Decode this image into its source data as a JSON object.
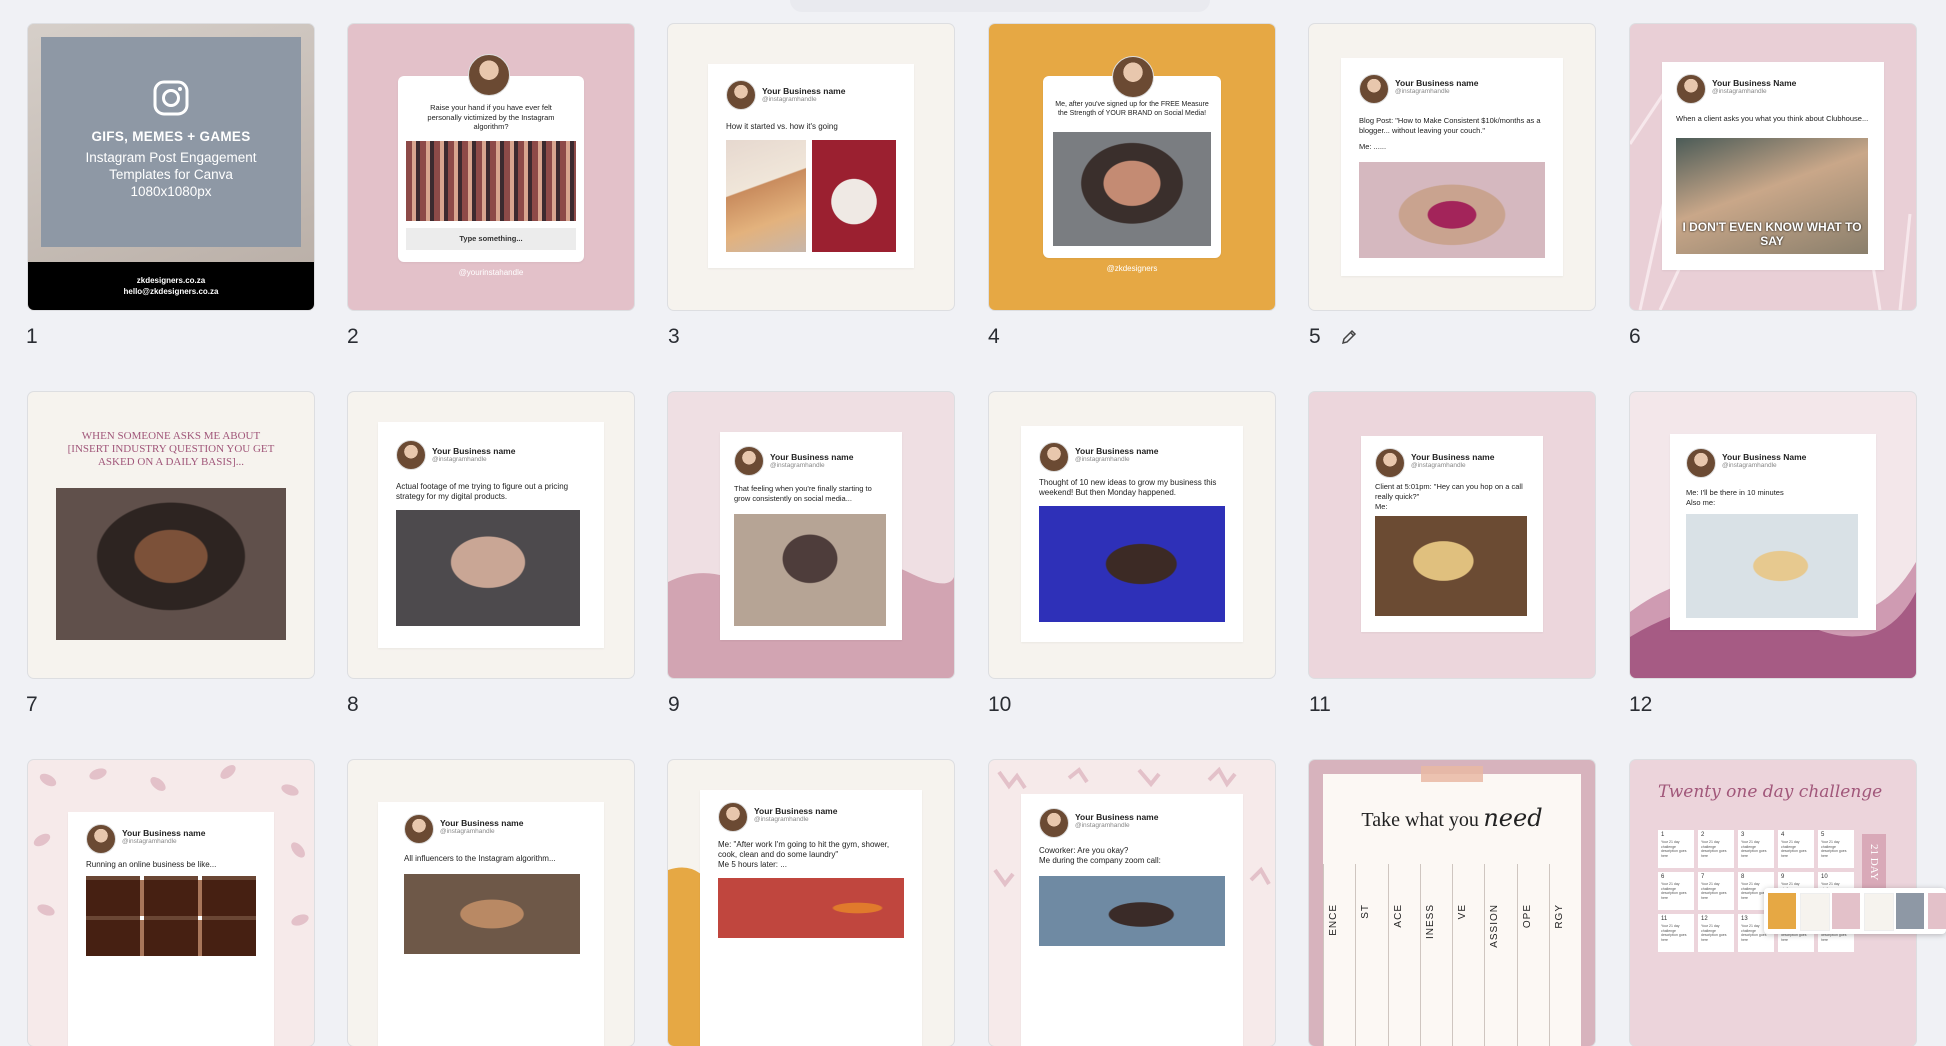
{
  "pages": [
    {
      "num": "1",
      "cover": {
        "title": "GIFS, MEMES + GAMES",
        "subtitle": "Instagram Post Engagement Templates for Canva 1080x1080px",
        "site": "zkdesigners.co.za",
        "email": "hello@zkdesigners.co.za"
      }
    },
    {
      "num": "2",
      "caption": "Raise your hand if you have ever felt personally victimized by the Instagram algorithm?",
      "input_placeholder": "Type something...",
      "handle": "@yourinstahandle"
    },
    {
      "num": "3",
      "business": "Your Business name",
      "handle": "@instagramhandle",
      "caption": "How it started vs. how it's going"
    },
    {
      "num": "4",
      "caption": "Me, after you've signed up for the FREE Measure the Strength of YOUR BRAND on Social Media!",
      "handle": "@zkdesigners"
    },
    {
      "num": "5",
      "business": "Your Business name",
      "handle": "@instagramhandle",
      "caption": "Blog Post: \"How to Make Consistent $10k/months as a blogger... without leaving your couch.\"",
      "caption2": "Me: ......"
    },
    {
      "num": "6",
      "business": "Your Business Name",
      "handle": "@instagramhandle",
      "caption": "When a client asks you what you think about Clubhouse...",
      "meme_text": "I DON'T EVEN KNOW WHAT TO SAY"
    },
    {
      "num": "7",
      "heading": "WHEN SOMEONE ASKS ME ABOUT [INSERT INDUSTRY QUESTION YOU GET ASKED ON A DAILY BASIS]..."
    },
    {
      "num": "8",
      "business": "Your Business name",
      "handle": "@instagramhandle",
      "caption": "Actual footage of me trying to figure out a pricing strategy for my digital products."
    },
    {
      "num": "9",
      "business": "Your Business name",
      "handle": "@instagramhandle",
      "caption": "That feeling when you're finally starting to grow consistently on social media..."
    },
    {
      "num": "10",
      "business": "Your Business name",
      "handle": "@instagramhandle",
      "caption": "Thought of 10 new ideas to grow my business this weekend! But then Monday happened."
    },
    {
      "num": "11",
      "business": "Your Business name",
      "handle": "@instagramhandle",
      "caption": "Client at 5:01pm: \"Hey can you hop on a call really quick?\"",
      "caption2": "Me:"
    },
    {
      "num": "12",
      "business": "Your Business Name",
      "handle": "@instagramhandle",
      "caption": "Me: I'll be there in 10 minutes",
      "caption2": "Also me:"
    },
    {
      "business": "Your Business name",
      "handle": "@instagramhandle",
      "caption": "Running an online business be like..."
    },
    {
      "business": "Your Business name",
      "handle": "@instagramhandle",
      "caption": "All influencers to the Instagram algorithm..."
    },
    {
      "business": "Your Business name",
      "handle": "@instagramhandle",
      "caption": "Me: \"After work I'm going to hit the gym, shower, cook, clean and do some laundry\"",
      "caption2": "Me 5 hours later: ..."
    },
    {
      "business": "Your Business name",
      "handle": "@instagramhandle",
      "caption": "Coworker: Are you okay?",
      "caption2": "Me during the company zoom call:"
    },
    {
      "title_plain": "Take what you",
      "title_script": "need",
      "tabs": [
        "ENCE",
        "ST",
        "ACE",
        "INESS",
        "VE",
        "ASSION",
        "OPE",
        "RGY"
      ]
    },
    {
      "title": "Twenty one day challenge",
      "cell_text": "Your 21 day challenge description goes here",
      "side_text": "21 DAY"
    }
  ],
  "colors": {
    "pink": "#e3c1c9",
    "cream": "#f6f3ee",
    "mustard": "#e6a844",
    "light_pink": "#ecd6dc",
    "plum": "#a65b84",
    "slate": "#8e98a5"
  },
  "icons": {
    "edit": "pencil-icon",
    "instagram": "instagram-icon"
  }
}
